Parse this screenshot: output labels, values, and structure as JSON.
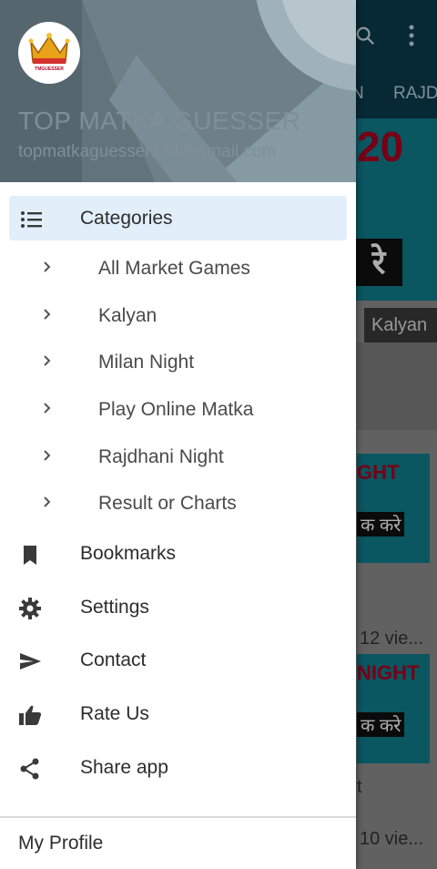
{
  "background_app": {
    "tabs": [
      "N",
      "RAJD"
    ],
    "banner_number": "20",
    "banner_cta": "रे",
    "chip": "Kalyan",
    "cards": [
      {
        "title": "GHT",
        "badge": "क करे"
      },
      {
        "title": "NIGHT",
        "badge": "क करे"
      }
    ],
    "views": [
      "12 vie...",
      "10 vie..."
    ],
    "partial_text": "t"
  },
  "drawer": {
    "header": {
      "logo_text": "TMGUESSER",
      "app_name": "TOP MATKA GUESSER",
      "email": "topmatkaguesser134@gmail.com"
    },
    "categories": {
      "label": "Categories",
      "icon": "list-icon",
      "selected": true
    },
    "subcategories": [
      {
        "label": "All Market Games"
      },
      {
        "label": "Kalyan"
      },
      {
        "label": "Milan Night"
      },
      {
        "label": "Play Online Matka"
      },
      {
        "label": "Rajdhani Night"
      },
      {
        "label": "Result or Charts"
      }
    ],
    "menu": [
      {
        "label": "Bookmarks",
        "icon": "bookmark-icon"
      },
      {
        "label": "Settings",
        "icon": "gear-icon"
      },
      {
        "label": "Contact",
        "icon": "send-icon"
      },
      {
        "label": "Rate Us",
        "icon": "thumbs-up-icon"
      },
      {
        "label": "Share app",
        "icon": "share-icon"
      }
    ],
    "footer": {
      "label": "My Profile"
    }
  },
  "colors": {
    "selected_bg": "#e2effb",
    "header_bg": "#62737c",
    "app_bar": "#0b3b4f",
    "banner": "#0f7f8f",
    "accent_red": "#b00020"
  }
}
